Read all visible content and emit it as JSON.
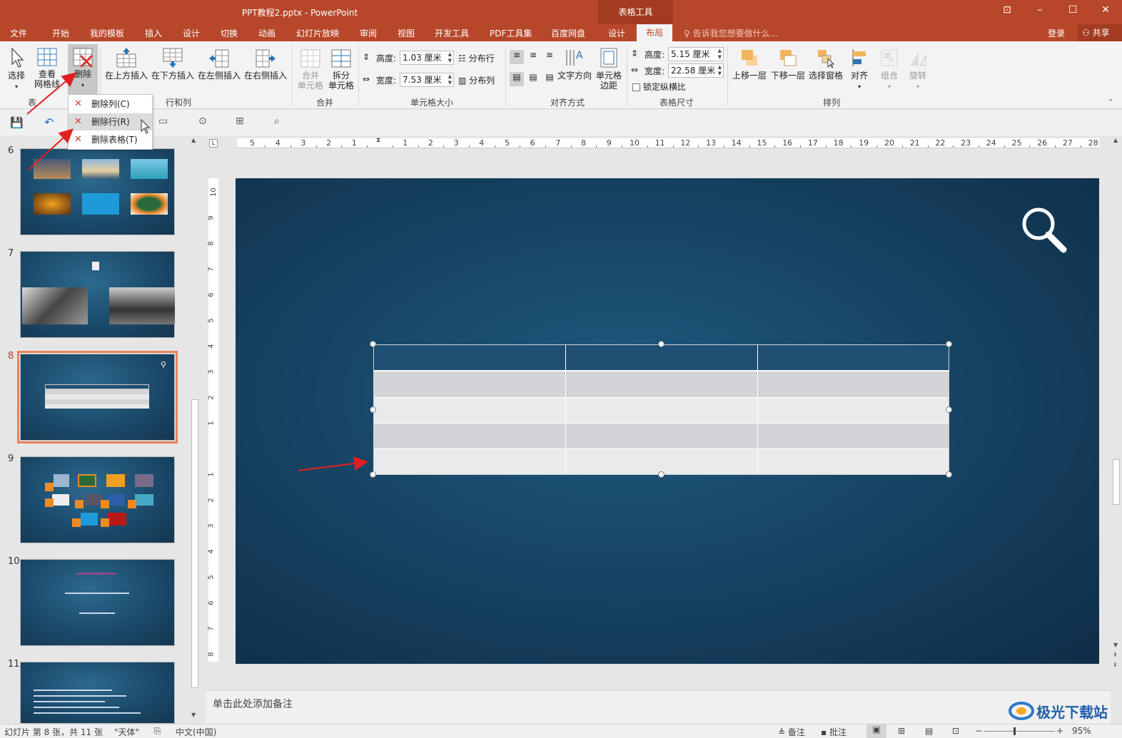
{
  "titlebar": {
    "title": "PPT教程2.pptx - PowerPoint",
    "context_tab": "表格工具"
  },
  "menu": {
    "items": [
      "文件",
      "开始",
      "我的模板",
      "插入",
      "设计",
      "切换",
      "动画",
      "幻灯片放映",
      "审阅",
      "视图",
      "开发工具",
      "PDF工具集",
      "百度网盘",
      "设计"
    ],
    "active_tab": "布局",
    "tell_me": "告诉我您想要做什么...",
    "login": "登录",
    "share": "共享"
  },
  "ribbon": {
    "select": "选择",
    "view_gridlines": "查看\n网格线",
    "delete": "删除",
    "insert_above": "在上方插入",
    "insert_below": "在下方插入",
    "insert_left": "在左侧插入",
    "insert_right": "在右侧插入",
    "merge_cells": "合并\n单元格",
    "split_cells": "拆分\n单元格",
    "height_label": "高度:",
    "height_value": "1.03 厘米",
    "width_label": "宽度:",
    "width_value": "7.53 厘米",
    "distribute_rows": "分布行",
    "distribute_cols": "分布列",
    "text_direction": "文字方向",
    "cell_margins": "单元格\n边距",
    "table_height_label": "高度:",
    "table_height_value": "5.15 厘米",
    "table_width_label": "宽度:",
    "table_width_value": "22.58 厘米",
    "lock_ratio": "锁定纵横比",
    "bring_forward": "上移一层",
    "send_backward": "下移一层",
    "selection_pane": "选择窗格",
    "align": "对齐",
    "group": "组合",
    "rotate": "旋转",
    "groups": {
      "table": "表",
      "rows_cols": "行和列",
      "merge": "合并",
      "cell_size": "单元格大小",
      "alignment": "对齐方式",
      "table_size": "表格尺寸",
      "arrange": "排列"
    }
  },
  "dropdown": {
    "delete_columns": "删除列(C)",
    "delete_rows": "删除行(R)",
    "delete_table": "删除表格(T)"
  },
  "slides": {
    "numbers": [
      "6",
      "7",
      "8",
      "9",
      "10",
      "11"
    ],
    "selected": "8"
  },
  "hruler_labels": [
    "5",
    "4",
    "3",
    "2",
    "1",
    "1",
    "2",
    "3",
    "4",
    "5",
    "6",
    "7",
    "8",
    "9",
    "10",
    "11",
    "12",
    "13",
    "14",
    "15",
    "16",
    "17",
    "18",
    "19",
    "20",
    "21",
    "22",
    "23",
    "24",
    "25",
    "26",
    "27",
    "28"
  ],
  "vruler_labels": [
    "10",
    "9",
    "8",
    "7",
    "6",
    "5",
    "4",
    "3",
    "2",
    "1",
    "1",
    "2",
    "3",
    "4",
    "5",
    "6",
    "7",
    "8"
  ],
  "notes": {
    "placeholder": "单击此处添加备注"
  },
  "status": {
    "slide_info": "幻灯片 第 8 张，共 11 张",
    "theme": "\"天体\"",
    "language": "中文(中国)",
    "notes": "备注",
    "comments": "批注",
    "zoom": "95%"
  },
  "watermark": "极光下载站",
  "colors": {
    "accent": "#b7472a",
    "table_header": "#1e4f72",
    "table_row_dark": "#d2d4d8",
    "table_row_light": "#e9eaec",
    "annotation_arrow": "#e02020"
  }
}
